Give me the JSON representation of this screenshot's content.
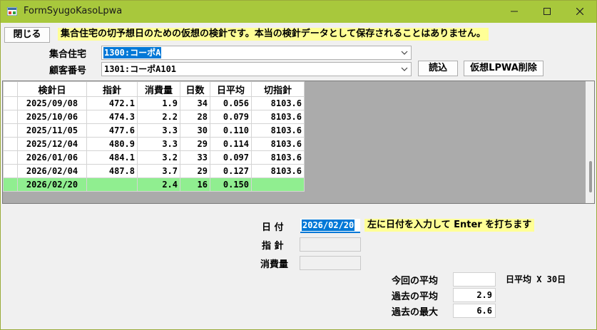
{
  "window": {
    "title": "FormSyugoKasoLpwa"
  },
  "toolbar": {
    "close_label": "閉じる",
    "notice": "集合住宅の切予想日のための仮想の検針です。本当の検針データとして保存されることはありません。"
  },
  "filters": {
    "complex_label": "集合住宅",
    "complex_value": "1300:コーポA",
    "customer_label": "顧客番号",
    "customer_value": "1301:コーポA101",
    "load_label": "読込",
    "delete_label": "仮想LPWA削除"
  },
  "grid": {
    "headers": [
      "検針日",
      "指針",
      "消費量",
      "日数",
      "日平均",
      "切指針"
    ],
    "rows": [
      [
        "2025/09/08",
        "472.1",
        "1.9",
        "34",
        "0.056",
        "8103.6"
      ],
      [
        "2025/10/06",
        "474.3",
        "2.2",
        "28",
        "0.079",
        "8103.6"
      ],
      [
        "2025/11/05",
        "477.6",
        "3.3",
        "30",
        "0.110",
        "8103.6"
      ],
      [
        "2025/12/04",
        "480.9",
        "3.3",
        "29",
        "0.114",
        "8103.6"
      ],
      [
        "2026/01/06",
        "484.1",
        "3.2",
        "33",
        "0.097",
        "8103.6"
      ],
      [
        "2026/02/04",
        "487.8",
        "3.7",
        "29",
        "0.127",
        "8103.6"
      ],
      [
        "2026/02/20",
        "",
        "2.4",
        "16",
        "0.150",
        ""
      ]
    ]
  },
  "entry": {
    "date_label": "日 付",
    "date_value": "2026/02/20",
    "date_hint": "左に日付を入力して Enter を打ちます",
    "reading_label": "指 針",
    "reading_value": "",
    "usage_label": "消費量",
    "usage_value": ""
  },
  "stats": {
    "current_avg_label": "今回の平均",
    "current_avg_value": "",
    "current_avg_note": "日平均 X 30日",
    "past_avg_label": "過去の平均",
    "past_avg_value": "2.9",
    "past_max_label": "過去の最大",
    "past_max_value": "6.6"
  },
  "colors": {
    "titlebar": "#a8c83c",
    "highlight_row": "#90ee90",
    "notice_bg": "#ffff96",
    "selection": "#0078d7"
  }
}
